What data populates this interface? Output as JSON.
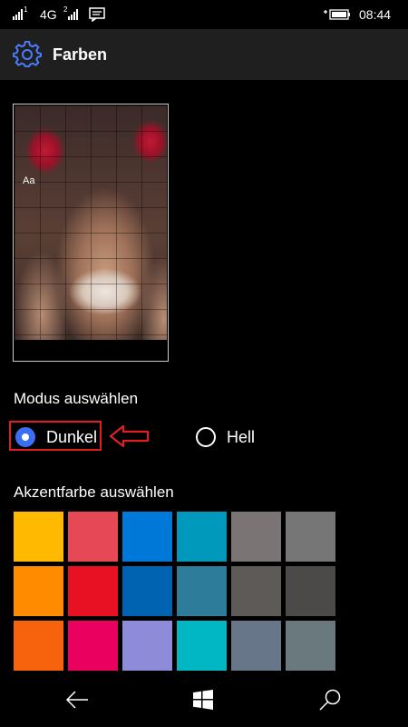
{
  "status": {
    "network": "4G",
    "sim1": "1",
    "sim2": "2",
    "time": "08:44"
  },
  "header": {
    "title": "Farben",
    "icon": "gear-icon"
  },
  "preview": {
    "tile_label": "Aa"
  },
  "mode": {
    "label": "Modus auswählen",
    "options": [
      {
        "label": "Dunkel",
        "selected": true
      },
      {
        "label": "Hell",
        "selected": false
      }
    ]
  },
  "accent": {
    "label": "Akzentfarbe auswählen",
    "colors": [
      [
        "#ffb900",
        "#e74856",
        "#0078d7",
        "#0099bc",
        "#7a7574",
        "#767676"
      ],
      [
        "#ff8c00",
        "#e81123",
        "#0063b1",
        "#2d7d9a",
        "#5d5a58",
        "#4c4a48"
      ],
      [
        "#f7630c",
        "#ea005e",
        "#8e8cd8",
        "#00b7c3",
        "#68768a",
        "#69797e"
      ]
    ]
  },
  "colors": {
    "header_bg": "#1f1f1f",
    "selected_radio": "#3a6ef3",
    "highlight": "#e02020"
  }
}
